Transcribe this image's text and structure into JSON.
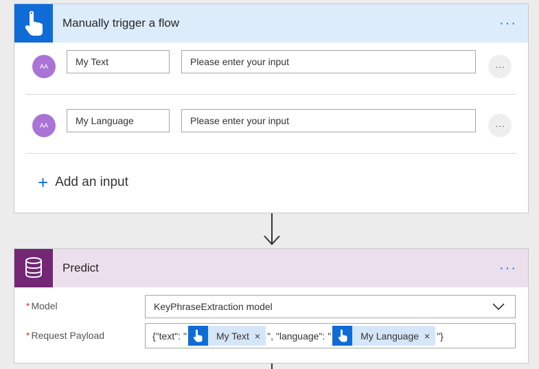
{
  "trigger": {
    "title": "Manually trigger a flow",
    "more": "···",
    "inputs": [
      {
        "avatar": "AA",
        "name": "My Text",
        "placeholder": "Please enter your input",
        "menu": "···"
      },
      {
        "avatar": "AA",
        "name": "My Language",
        "placeholder": "Please enter your input",
        "menu": "···"
      }
    ],
    "add_input_label": "Add an input",
    "add_input_icon": "+"
  },
  "predict": {
    "title": "Predict",
    "more": "···",
    "model": {
      "required_mark": "*",
      "label": "Model",
      "value": "KeyPhraseExtraction model"
    },
    "payload": {
      "required_mark": "*",
      "label": "Request Payload",
      "part1": "{\"text\": \"",
      "token1": "My Text",
      "part2": "\", \"language\": \"",
      "token2": "My Language",
      "part3": "\"}",
      "remove_glyph": "×"
    }
  },
  "colors": {
    "trigger_accent": "#0f6cd6",
    "predict_accent": "#742774",
    "avatar": "#a974d6"
  },
  "icons": {
    "trigger": "hand-tap-icon",
    "predict": "database-icon",
    "add": "plus-icon",
    "dropdown": "chevron-down-icon"
  }
}
